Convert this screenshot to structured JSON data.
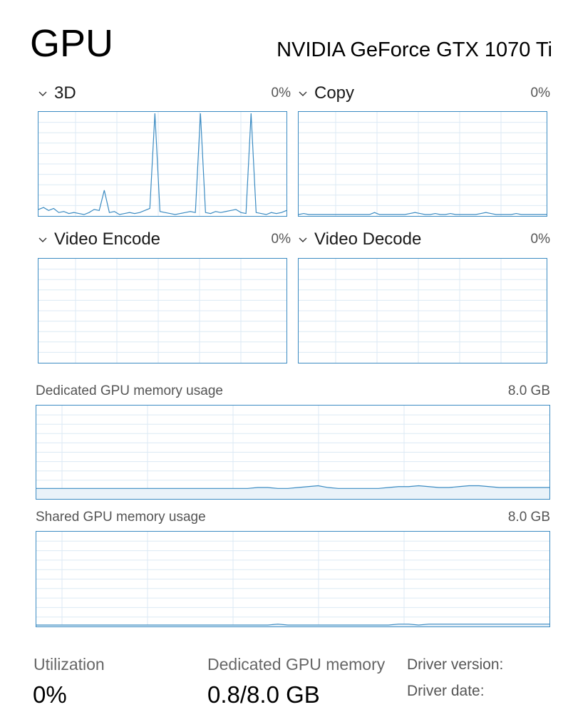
{
  "header": {
    "title": "GPU",
    "gpu_name": "NVIDIA GeForce GTX 1070 Ti"
  },
  "engines": [
    {
      "label": "3D",
      "percent": "0%",
      "samples": [
        0.05,
        0.07,
        0.04,
        0.06,
        0.02,
        0.03,
        0.01,
        0.02,
        0.01,
        0.0,
        0.02,
        0.05,
        0.04,
        0.24,
        0.02,
        0.03,
        0.0,
        0.01,
        0.02,
        0.01,
        0.02,
        0.04,
        0.06,
        1.0,
        0.03,
        0.02,
        0.01,
        0.0,
        0.01,
        0.02,
        0.03,
        0.02,
        1.0,
        0.02,
        0.01,
        0.03,
        0.02,
        0.03,
        0.04,
        0.05,
        0.02,
        0.01,
        1.0,
        0.02,
        0.01,
        0.0,
        0.02,
        0.01,
        0.02,
        0.04
      ]
    },
    {
      "label": "Copy",
      "percent": "0%",
      "samples": [
        0.0,
        0.01,
        0.0,
        0.0,
        0.0,
        0.0,
        0.0,
        0.0,
        0.0,
        0.0,
        0.0,
        0.0,
        0.0,
        0.0,
        0.0,
        0.02,
        0.0,
        0.0,
        0.0,
        0.0,
        0.0,
        0.0,
        0.01,
        0.02,
        0.01,
        0.0,
        0.0,
        0.01,
        0.0,
        0.0,
        0.01,
        0.0,
        0.0,
        0.0,
        0.0,
        0.0,
        0.01,
        0.02,
        0.01,
        0.0,
        0.0,
        0.0,
        0.0,
        0.01,
        0.0,
        0.0,
        0.0,
        0.0,
        0.0,
        0.0
      ]
    },
    {
      "label": "Video Encode",
      "percent": "0%",
      "samples": []
    },
    {
      "label": "Video Decode",
      "percent": "0%",
      "samples": []
    }
  ],
  "memory": {
    "dedicated": {
      "label": "Dedicated GPU memory usage",
      "max": "8.0 GB",
      "samples": [
        0.1,
        0.1,
        0.1,
        0.1,
        0.1,
        0.1,
        0.1,
        0.1,
        0.1,
        0.1,
        0.1,
        0.1,
        0.1,
        0.1,
        0.1,
        0.1,
        0.1,
        0.1,
        0.1,
        0.1,
        0.1,
        0.1,
        0.11,
        0.11,
        0.1,
        0.1,
        0.11,
        0.12,
        0.13,
        0.11,
        0.1,
        0.1,
        0.1,
        0.1,
        0.1,
        0.11,
        0.12,
        0.12,
        0.13,
        0.12,
        0.11,
        0.11,
        0.12,
        0.13,
        0.13,
        0.12,
        0.11,
        0.11,
        0.11,
        0.11,
        0.11,
        0.11
      ]
    },
    "shared": {
      "label": "Shared GPU memory usage",
      "max": "8.0 GB",
      "samples": [
        0.0,
        0.0,
        0.0,
        0.0,
        0.0,
        0.0,
        0.0,
        0.0,
        0.0,
        0.0,
        0.0,
        0.0,
        0.0,
        0.0,
        0.0,
        0.0,
        0.0,
        0.0,
        0.0,
        0.0,
        0.0,
        0.0,
        0.0,
        0.0,
        0.01,
        0.0,
        0.0,
        0.0,
        0.0,
        0.0,
        0.0,
        0.0,
        0.0,
        0.0,
        0.0,
        0.0,
        0.01,
        0.01,
        0.0,
        0.01,
        0.01,
        0.01,
        0.01,
        0.01,
        0.01,
        0.01,
        0.01,
        0.01,
        0.01,
        0.01,
        0.01,
        0.01
      ]
    }
  },
  "stats": {
    "utilization_label": "Utilization",
    "utilization_value": "0%",
    "dedicated_memory_label": "Dedicated GPU memory",
    "dedicated_memory_value": "0.8/8.0 GB",
    "driver_version_label": "Driver version:",
    "driver_date_label": "Driver date:"
  },
  "colors": {
    "graph_border": "#3b8bc2",
    "graph_line": "#3b8bc2",
    "grid": "#dceaf4",
    "fill": "#e9f2f9"
  }
}
